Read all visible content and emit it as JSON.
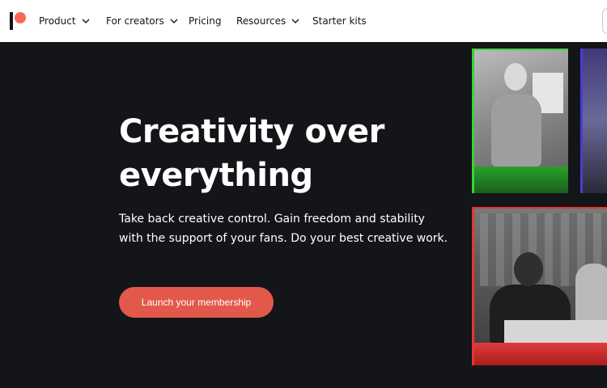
{
  "nav": {
    "items": [
      {
        "label": "Product",
        "has_dropdown": true
      },
      {
        "label": "For creators",
        "has_dropdown": true
      },
      {
        "label": "Pricing",
        "has_dropdown": false
      },
      {
        "label": "Resources",
        "has_dropdown": true
      },
      {
        "label": "Starter kits",
        "has_dropdown": false
      }
    ],
    "logo_icon": "patreon-logo-icon",
    "dropdown_icon": "chevron-down-icon"
  },
  "hero": {
    "title_line1": "Creativity over",
    "title_line2": "everything",
    "subtitle": "Take back creative control. Gain freedom and stability with the support of your fans. Do your best creative work.",
    "cta_label": "Launch your membership"
  },
  "colors": {
    "background": "#141518",
    "accent": "#e2594b",
    "logo_dot": "#f96854"
  }
}
